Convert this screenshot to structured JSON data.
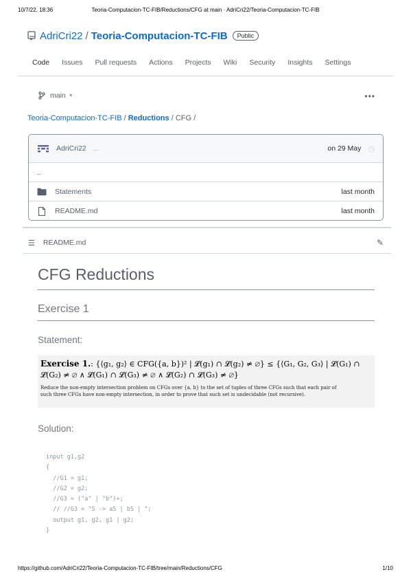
{
  "print_header": {
    "datetime": "10/7/22, 18:36",
    "title": "Teoria-Computacion-TC-FIB/Reductions/CFG at main · AdriCri22/Teoria-Computacion-TC-FIB"
  },
  "repo": {
    "owner": "AdriCri22",
    "separator": "/",
    "name": "Teoria-Computacion-TC-FIB",
    "visibility": "Public"
  },
  "tabs": [
    "Code",
    "Issues",
    "Pull requests",
    "Actions",
    "Projects",
    "Wiki",
    "Security",
    "Insights",
    "Settings"
  ],
  "branch": {
    "name": "main"
  },
  "breadcrumb": {
    "repo": "Teoria-Computacion-TC-FIB",
    "sep1": "/",
    "folder": "Reductions",
    "sep2": "/",
    "current": "CFG",
    "sep3": "/"
  },
  "commit": {
    "author": "AdriCri22",
    "more": "...",
    "date": "on 29 May"
  },
  "files": [
    {
      "name": "..",
      "date": "",
      "type": "parent"
    },
    {
      "name": "Statements",
      "date": "last month",
      "type": "folder"
    },
    {
      "name": "README.md",
      "date": "last month",
      "type": "file"
    }
  ],
  "readme": {
    "filename": "README.md",
    "h1": "CFG Reductions",
    "h2": "Exercise 1",
    "statement_heading": "Statement:",
    "solution_heading": "Solution:",
    "statement": {
      "title": "Exercise 1.",
      "formula_line1": ": {⟨g₁, g₂⟩ ∈ CFG({a, b})² | 𝓛(g₁) ∩ 𝓛(g₂) ≠ ∅}   ≤   {⟨G₁, G₂, G₃⟩ | 𝓛(G₁) ∩",
      "formula_line2": "𝓛(G₂) ≠ ∅ ∧ 𝓛(G₁) ∩ 𝓛(G₃) ≠ ∅ ∧ 𝓛(G₂) ∩ 𝓛(G₃) ≠ ∅}",
      "text_line1": "Reduce the non-empty intersection problem on CFGs over {a, b} to the set of tuples of three CFGs such that each pair of",
      "text_line2": "such three CFGs have non-empty intersection, in order to prove that such set is undecidable (not recursive)."
    },
    "code_lines": [
      "input g1,g2",
      "{",
      "  //G1 = g1;",
      "  //G2 = g2;",
      "  //G3 = (\"a\" | \"b\")+;",
      "  // //G3 = \"S -> aS | bS | \";",
      "  output g1, g2, g1 | g2;",
      "}"
    ]
  },
  "print_footer": {
    "url": "https://github.com/AdriCri22/Teoria-Computacion-TC-FIB/tree/main/Reductions/CFG",
    "page": "1/10"
  }
}
